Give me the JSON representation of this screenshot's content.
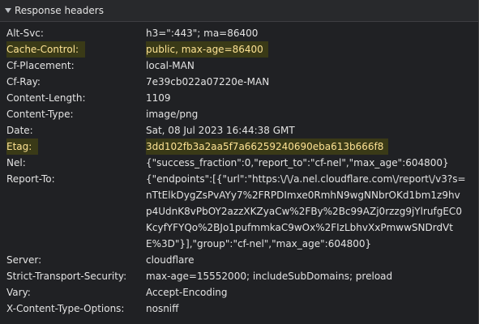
{
  "section": {
    "title": "Response headers"
  },
  "headers": [
    {
      "name": "Alt-Svc:",
      "value": "h3=\":443\"; ma=86400",
      "highlight": false
    },
    {
      "name": "Cache-Control:",
      "value": "public, max-age=86400",
      "highlight": true
    },
    {
      "name": "Cf-Placement:",
      "value": "local-MAN",
      "highlight": false
    },
    {
      "name": "Cf-Ray:",
      "value": "7e39cb022a07220e-MAN",
      "highlight": false
    },
    {
      "name": "Content-Length:",
      "value": "1109",
      "highlight": false
    },
    {
      "name": "Content-Type:",
      "value": "image/png",
      "highlight": false
    },
    {
      "name": "Date:",
      "value": "Sat, 08 Jul 2023 16:44:38 GMT",
      "highlight": false
    },
    {
      "name": "Etag:",
      "value": "3dd102fb3a2aa5f7a66259240690eba613b666f8",
      "highlight": true
    },
    {
      "name": "Nel:",
      "value": "{\"success_fraction\":0,\"report_to\":\"cf-nel\",\"max_age\":604800}",
      "highlight": false
    },
    {
      "name": "Report-To:",
      "value": "{\"endpoints\":[{\"url\":\"https:\\/\\/a.nel.cloudflare.com\\/report\\/v3?s=nTtElkDygZsPvAYy7%2FRPDImxe0RmhN9wgNNbrOKd1bm1z9hvp4UdnK8vPbOY2azzXKZyaCw%2FBy%2Bc99AZj0rzzg9jYlrufgEC0KcyfYFYQo%2BJo1pufmmkaC9wOx%2FIzLbhvXxPmwwSNDrdVtE%3D\"}],\"group\":\"cf-nel\",\"max_age\":604800}",
      "highlight": false
    },
    {
      "name": "Server:",
      "value": "cloudflare",
      "highlight": false
    },
    {
      "name": "Strict-Transport-Security:",
      "value": "max-age=15552000; includeSubDomains; preload",
      "highlight": false
    },
    {
      "name": "Vary:",
      "value": "Accept-Encoding",
      "highlight": false
    },
    {
      "name": "X-Content-Type-Options:",
      "value": "nosniff",
      "highlight": false
    }
  ],
  "colors": {
    "background": "#202124",
    "text": "#e3e3e3",
    "highlight_background": "#3a3a17",
    "highlight_text": "#fde293"
  },
  "icons": {
    "section_toggle": "triangle-down-icon"
  }
}
